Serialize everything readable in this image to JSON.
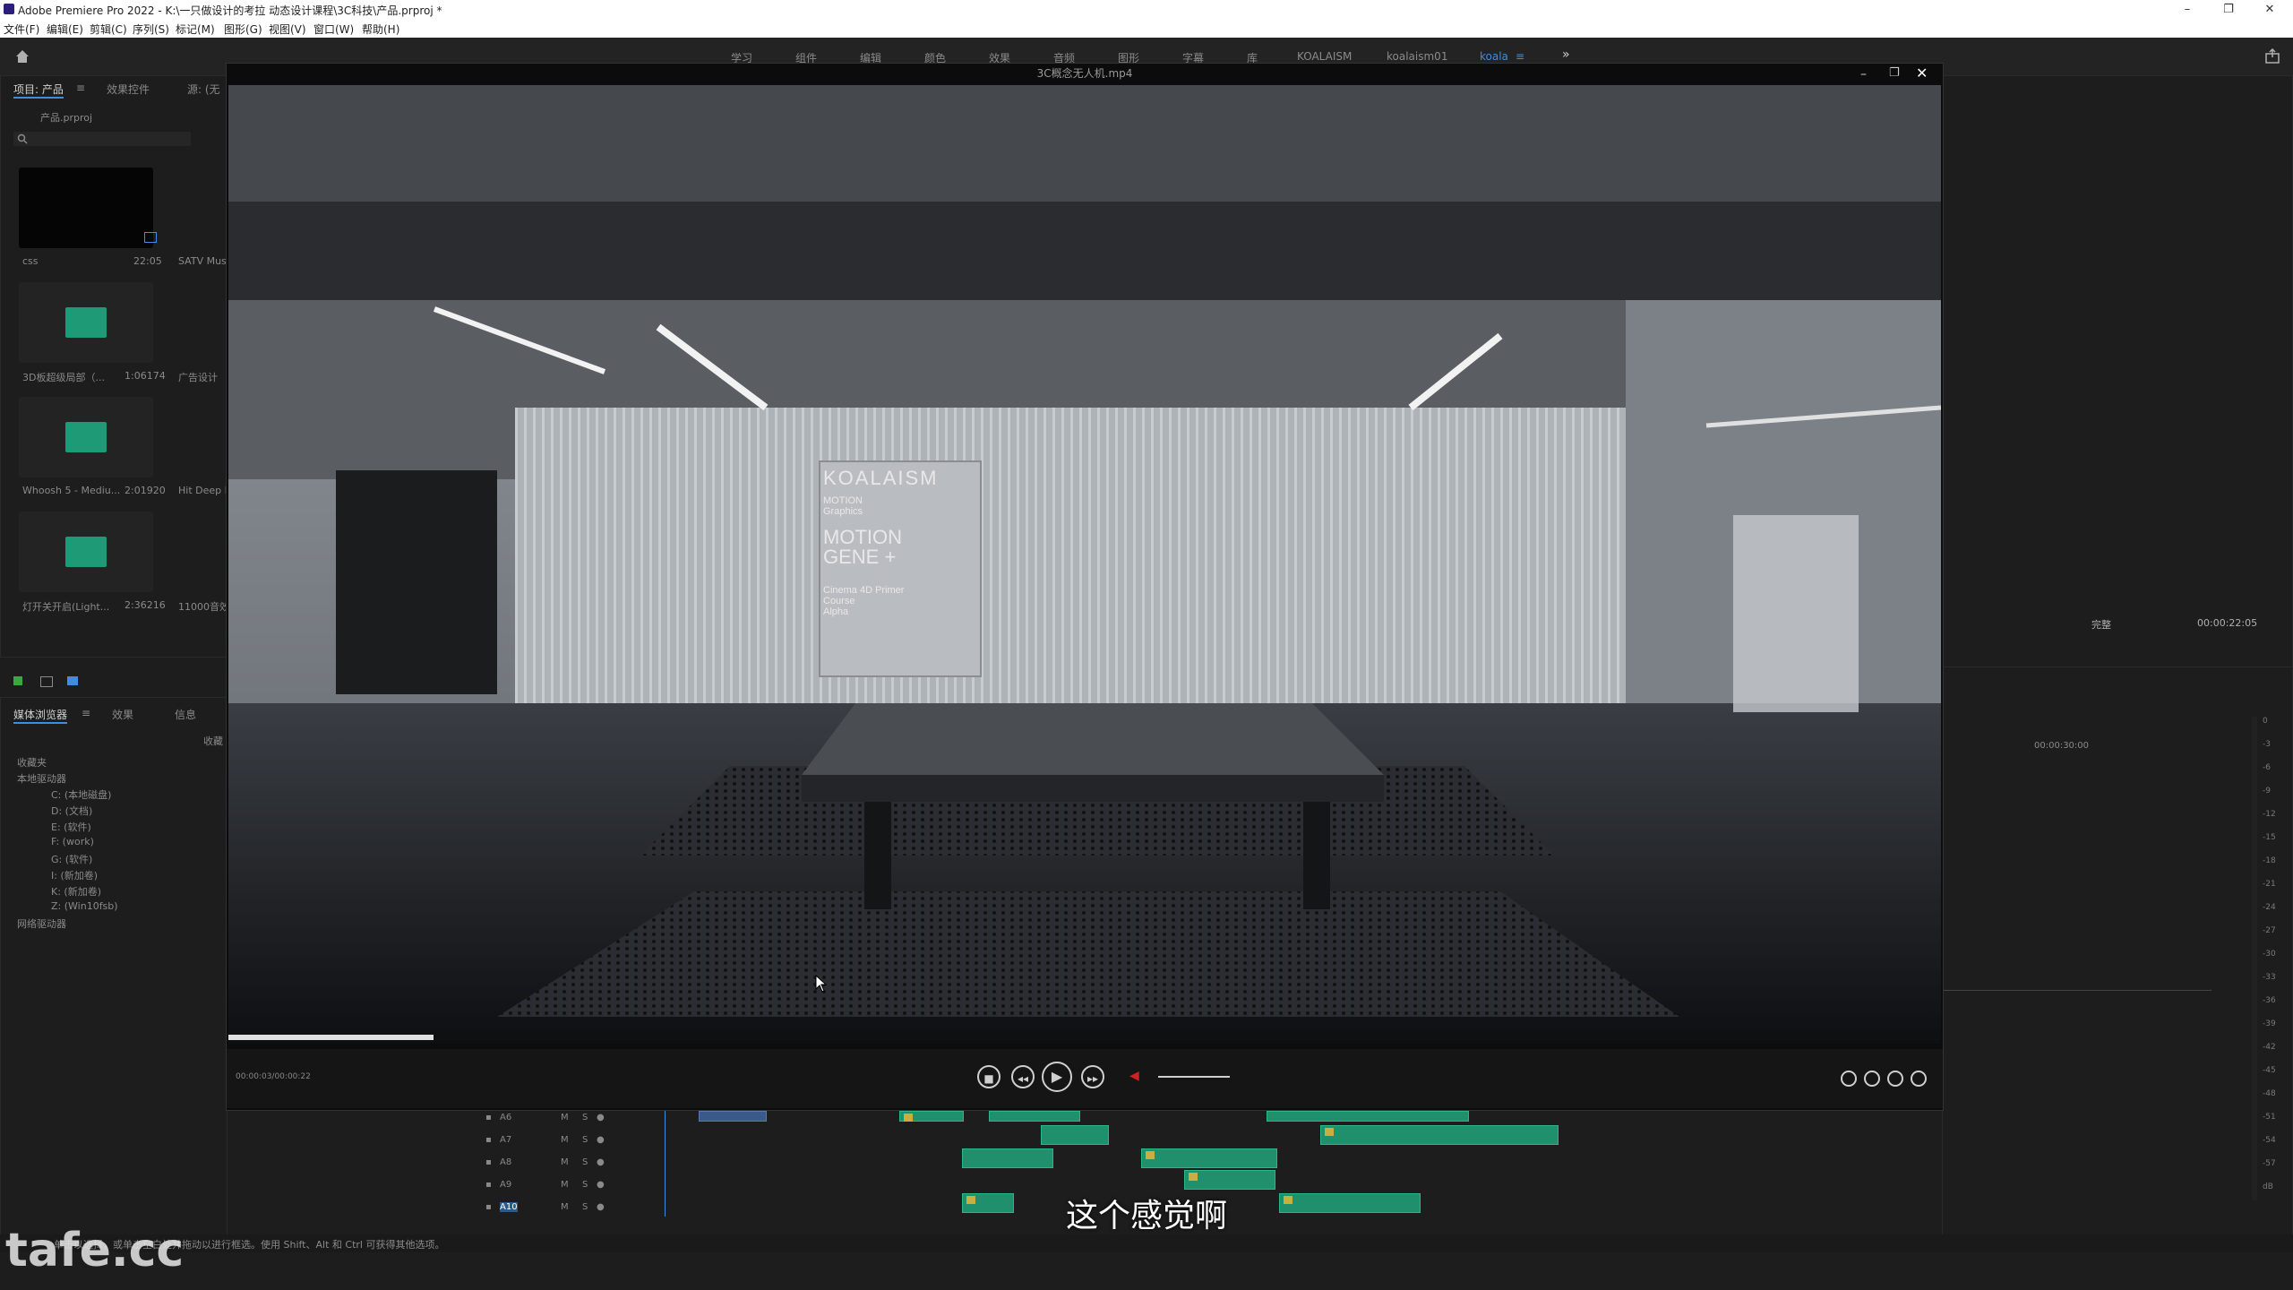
{
  "window": {
    "title": "Adobe Premiere Pro 2022 - K:\\一只做设计的考拉 动态设计课程\\3C科技\\产品.prproj *",
    "controls": {
      "minimize": "–",
      "restore": "❐",
      "close": "✕"
    }
  },
  "menu": [
    "文件(F)",
    "编辑(E)",
    "剪辑(C)",
    "序列(S)",
    "标记(M)",
    "图形(G)",
    "视图(V)",
    "窗口(W)",
    "帮助(H)"
  ],
  "workspaces": [
    "学习",
    "组件",
    "编辑",
    "颜色",
    "效果",
    "音频",
    "图形",
    "字幕",
    "库",
    "KOALAISM",
    "koalaism01",
    "koala",
    "≡",
    "»"
  ],
  "active_workspace": "koala",
  "project_panel": {
    "tabs": [
      "项目: 产品",
      "≡",
      "效果控件",
      "源: (无"
    ],
    "project_file": "产品.prproj",
    "items": [
      {
        "name": "css",
        "duration": "22:05",
        "next": "SATV Musi"
      },
      {
        "name": "3D板超级局部（...",
        "duration": "1:06174",
        "next": "广告设计"
      },
      {
        "name": "Whoosh 5 - Mediu...",
        "duration": "2:01920",
        "next": "Hit Deep Ir"
      },
      {
        "name": "灯开关开启(Light...",
        "duration": "2:36216",
        "next": "11000音效"
      }
    ]
  },
  "media_browser": {
    "tabs": [
      "媒体浏览器",
      "≡",
      "效果",
      "信息"
    ],
    "checkbox_label": "收藏",
    "tree": [
      "收藏夹",
      "本地驱动器",
      "C: (本地磁盘)",
      "D: (文档)",
      "E: (软件)",
      "F: (work)",
      "G: (软件)",
      "I: (新加卷)",
      "K: (新加卷)",
      "Z: (Win10fsb)",
      "网络驱动器"
    ]
  },
  "program_monitor": {
    "fit_label": "完整",
    "timecode": "00:00:22:05",
    "ruler_time": "00:00:30:00"
  },
  "player": {
    "filename": "3C概念无人机.mp4",
    "time": "00:00:03/00:00:22",
    "progress": 0.12,
    "banner": {
      "brand": "KOALAISM",
      "line1": "MOTION",
      "line2": "Graphics",
      "headline1": "MOTION",
      "headline2": "GENE +",
      "sub1": "Cinema 4D  Primer",
      "sub2": "Course",
      "sub3": "Alpha"
    }
  },
  "timeline": {
    "tracks": [
      "A6",
      "A7",
      "A8",
      "A9",
      "A10"
    ],
    "track_buttons": {
      "lock": "🔒",
      "m": "M",
      "s": "S"
    },
    "db_scale": [
      "0",
      "-3",
      "-6",
      "-9",
      "-12",
      "-15",
      "-18",
      "-21",
      "-24",
      "-27",
      "-30",
      "-33",
      "-36",
      "-39",
      "-42",
      "-45",
      "-48",
      "-51",
      "-54",
      "-57",
      "dB"
    ]
  },
  "subtitle": "这个感觉啊",
  "status_text": "单击以选择，或单击空白处并拖动以进行框选。使用 Shift、Alt 和 Ctrl 可获得其他选项。",
  "watermark": "tafe.cc",
  "icons": {
    "home": "home-icon",
    "search": "search-icon",
    "share": "share-icon",
    "stop": "stop-icon",
    "rewind": "rewind-icon",
    "play": "play-icon",
    "forward": "forward-icon",
    "volume": "volume-icon"
  }
}
